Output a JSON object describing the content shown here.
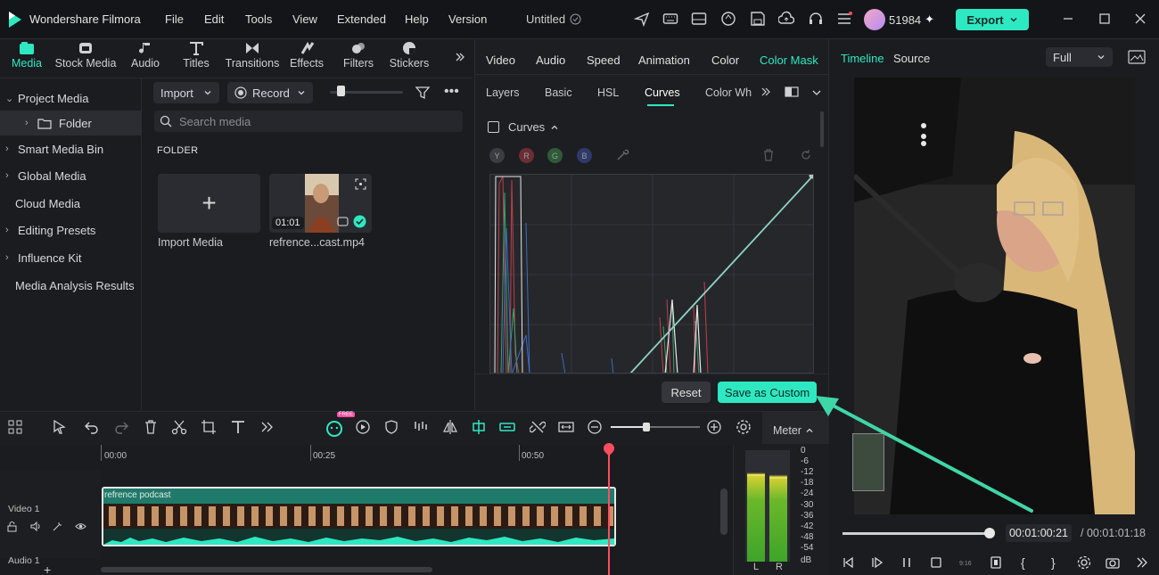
{
  "app": {
    "name": "Wondershare Filmora",
    "doc_title": "Untitled",
    "credits": "51984",
    "export_label": "Export",
    "menu": [
      "File",
      "Edit",
      "Tools",
      "View",
      "Extended",
      "Help",
      "Version"
    ]
  },
  "left_tabs": [
    "Media",
    "Stock Media",
    "Audio",
    "Titles",
    "Transitions",
    "Effects",
    "Filters",
    "Stickers"
  ],
  "sidebar": {
    "items": [
      "Project Media",
      "Folder",
      "Smart Media Bin",
      "Global Media",
      "Cloud Media",
      "Editing Presets",
      "Influence Kit",
      "Media Analysis Results"
    ]
  },
  "media": {
    "import_label": "Import",
    "record_label": "Record",
    "search_placeholder": "Search media",
    "folder_heading": "FOLDER",
    "import_media_label": "Import Media",
    "clip_name": "refrence...cast.mp4",
    "clip_duration": "01:01"
  },
  "properties": {
    "tabs": [
      "Video",
      "Audio",
      "Speed",
      "Animation",
      "Color",
      "Color Mask"
    ],
    "subtabs": [
      "Layers",
      "Basic",
      "HSL",
      "Curves",
      "Color Wh"
    ],
    "curves_label": "Curves",
    "channels": [
      "Y",
      "R",
      "G",
      "B"
    ],
    "reset_label": "Reset",
    "save_custom_label": "Save as Custom"
  },
  "preview": {
    "tab_timeline": "Timeline",
    "tab_source": "Source",
    "quality": "Full",
    "timecode": "00:01:00:21",
    "total": "/ 00:01:01:18",
    "progress": 0.985
  },
  "timeline": {
    "ruler": [
      "00:00",
      "00:25",
      "00:50"
    ],
    "video_track": "Video 1",
    "audio_track": "Audio 1",
    "clip_title": "refrence podcast",
    "meter_label": "Meter",
    "free_badge": "FREE",
    "db_scale": [
      "0",
      "-6",
      "-12",
      "-18",
      "-24",
      "-30",
      "-36",
      "-42",
      "-48",
      "-54",
      "dB"
    ],
    "lr": [
      "L",
      "R"
    ]
  },
  "colors": {
    "accent": "#2ee8c2",
    "playhead": "#ff4d5e",
    "clip": "#1f7a6a"
  }
}
